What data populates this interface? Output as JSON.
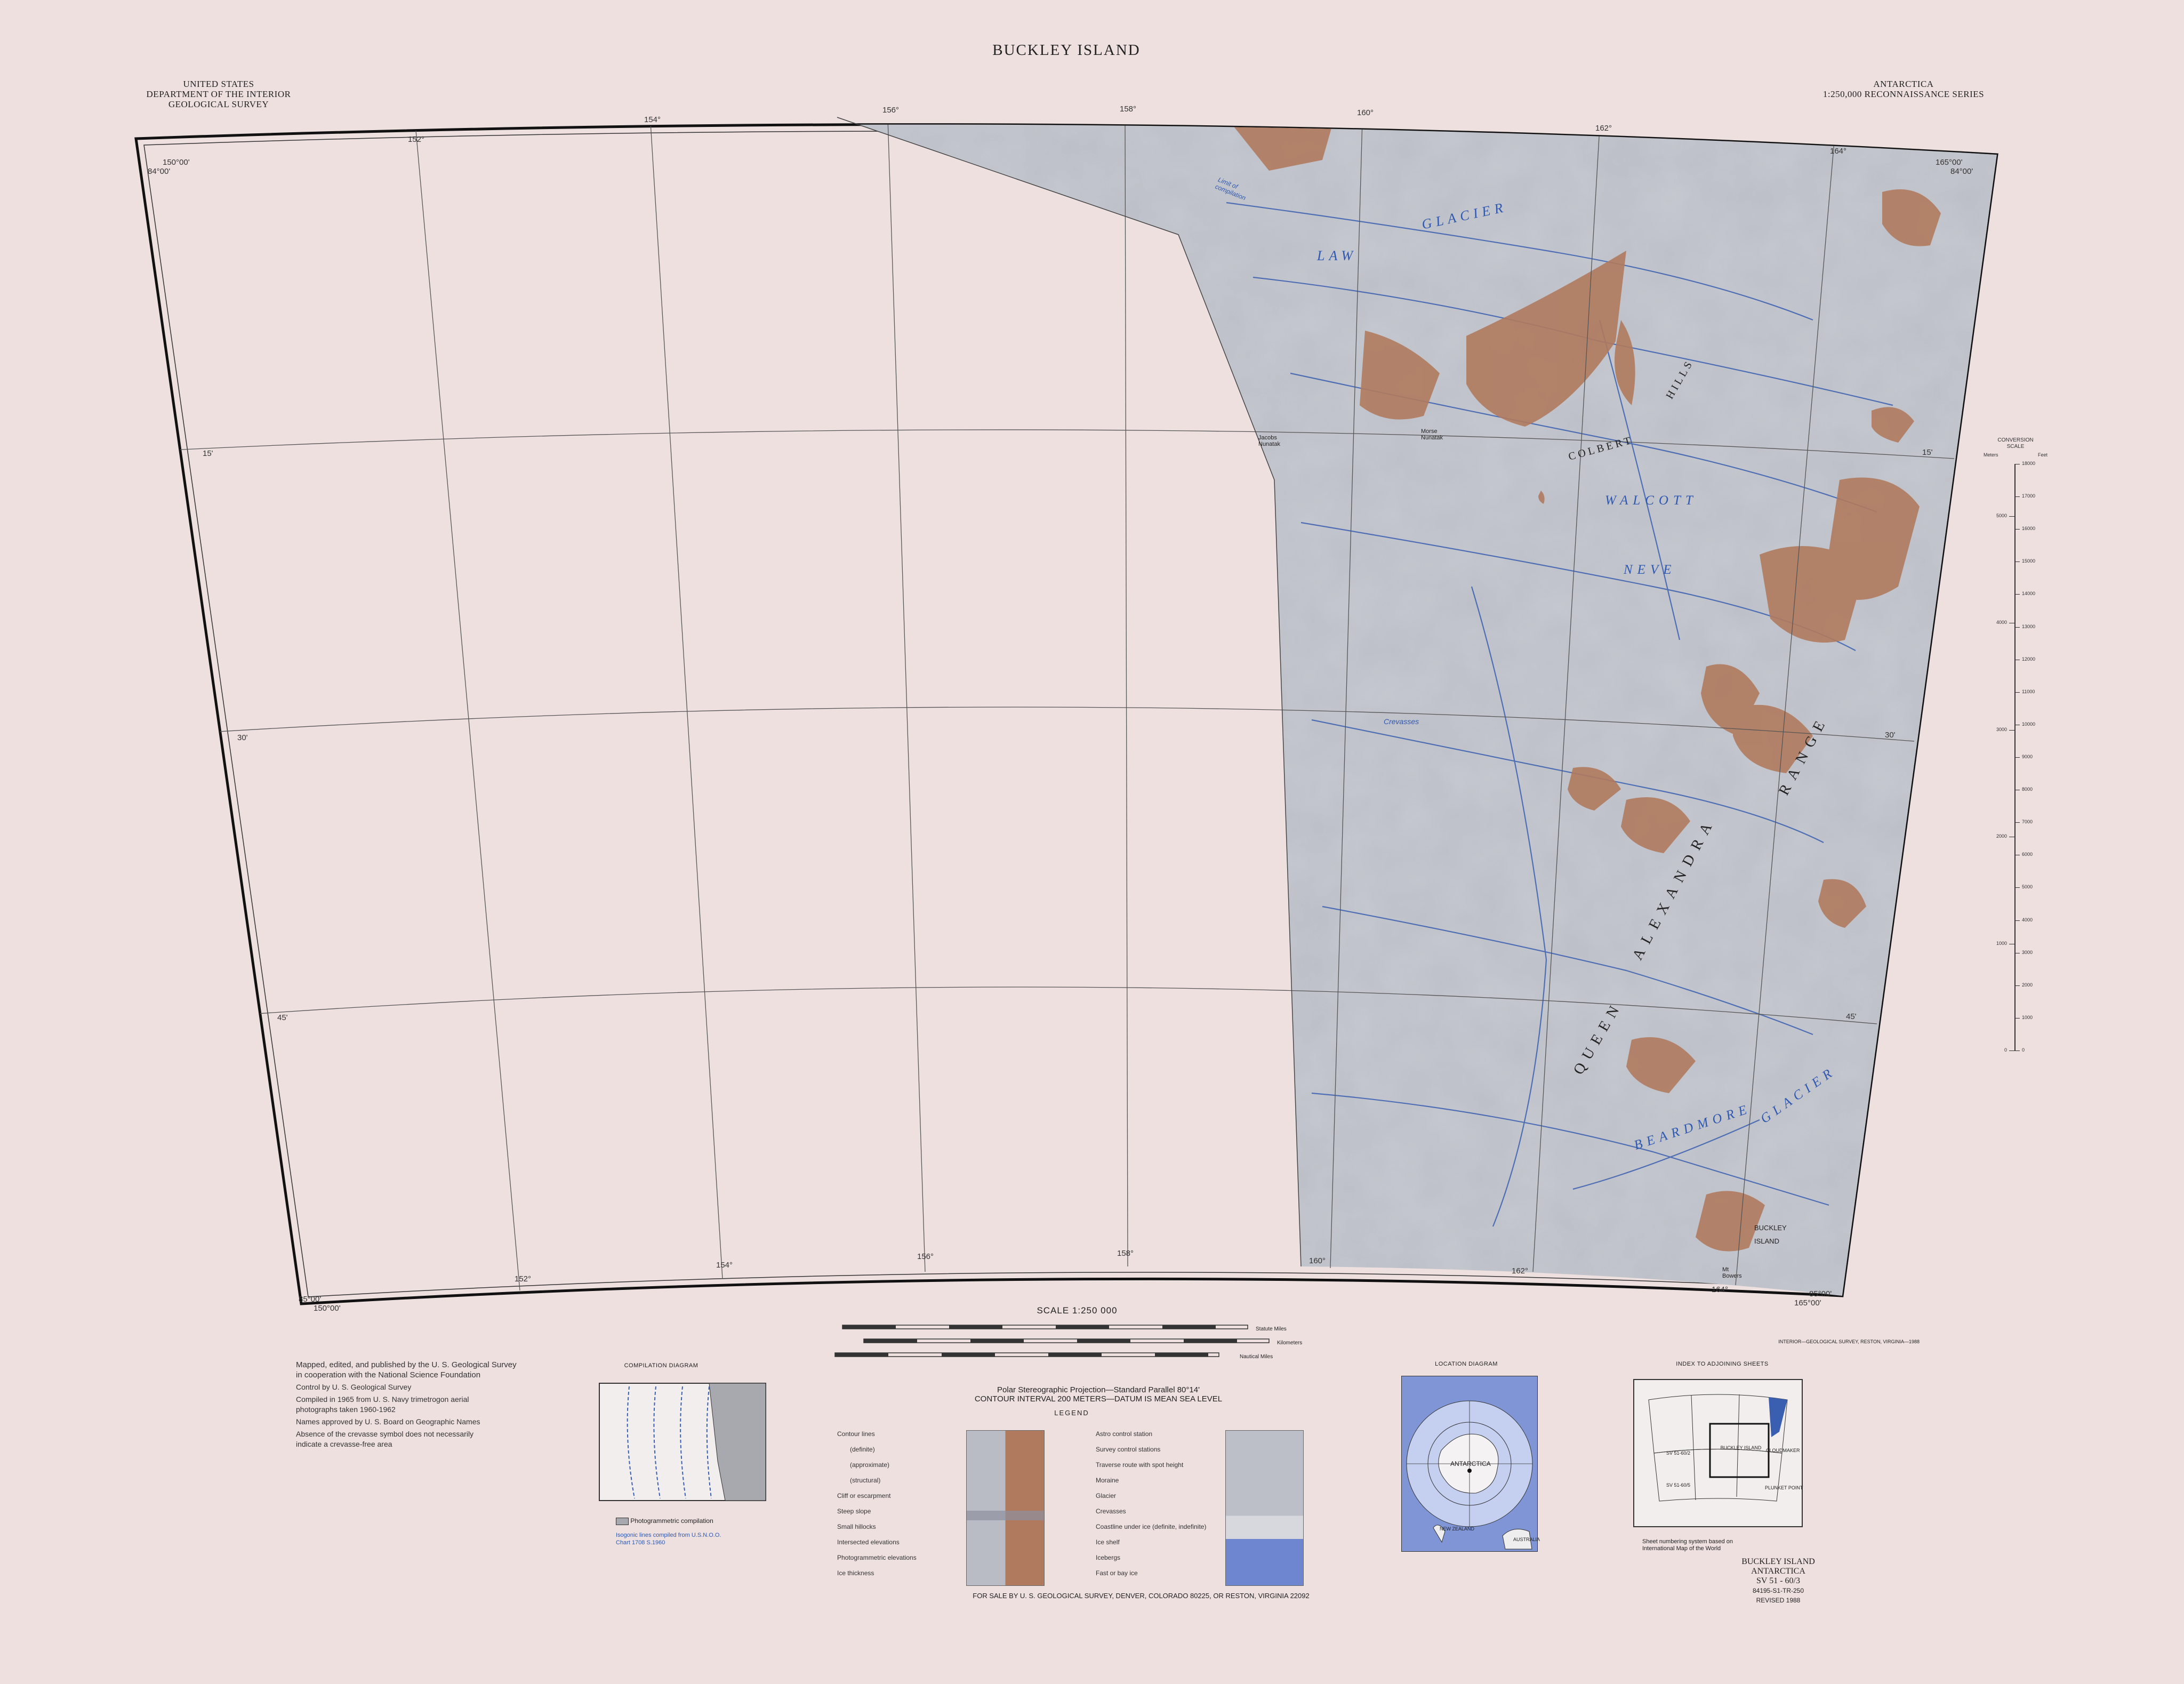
{
  "header": {
    "title": "BUCKLEY ISLAND",
    "agency": [
      "UNITED STATES",
      "DEPARTMENT OF THE INTERIOR",
      "GEOLOGICAL SURVEY"
    ],
    "series": [
      "ANTARCTICA",
      "1:250,000 RECONNAISSANCE SERIES"
    ]
  },
  "graticule": {
    "top_longitudes": [
      "152°",
      "154°",
      "156°",
      "158°",
      "160°",
      "162°",
      "164°"
    ],
    "bottom_longitudes": [
      "152°",
      "154°",
      "156°",
      "158°",
      "160°",
      "162°",
      "164°"
    ],
    "corner_tl": [
      "150°00'",
      "84°00'"
    ],
    "corner_tr": [
      "165°00'",
      "84°00'"
    ],
    "corner_bl": [
      "85°00'",
      "150°00'"
    ],
    "corner_br": [
      "85°00'",
      "165°00'"
    ],
    "left_latitudes": [
      "15'",
      "30'",
      "45'"
    ],
    "right_latitudes": [
      "15'",
      "30'",
      "45'"
    ]
  },
  "place_names": {
    "law_glacier": [
      "LAW",
      "GLACIER"
    ],
    "colbert_hills": [
      "COLBERT",
      "HILLS"
    ],
    "walcott_neve": [
      "WALCOTT",
      "NEVE"
    ],
    "queen_alexandra_range": [
      "QUEEN",
      "ALEXANDRA",
      "RANGE"
    ],
    "beardmore_glacier": [
      "BEARDMORE",
      "GLACIER"
    ],
    "buckley_island": [
      "BUCKLEY",
      "ISLAND"
    ],
    "crevasses": "Crevasses",
    "limit_of_compilation": "Limit of compilation",
    "morse_nunatak": "Morse Nunatak",
    "jacobs_nunatak": "Jacobs Nunatak",
    "mt_bowers": "Mt Bowers"
  },
  "elevation_scale": {
    "title": [
      "CONVERSION",
      "SCALE"
    ],
    "units": [
      "Meters",
      "Feet"
    ],
    "meters": [
      "0",
      "1000",
      "2000",
      "3000",
      "4000",
      "5000"
    ],
    "feet": [
      "0",
      "1000",
      "2000",
      "3000",
      "4000",
      "5000",
      "6000",
      "7000",
      "8000",
      "9000",
      "10000",
      "11000",
      "12000",
      "13000",
      "14000",
      "15000",
      "16000",
      "17000",
      "18000"
    ]
  },
  "footer": {
    "credits": [
      "Mapped, edited, and published by the U. S. Geological Survey",
      "in cooperation with the National Science Foundation",
      "Control by U. S. Geological Survey",
      "Compiled in 1965 from U. S. Navy trimetrogon aerial",
      "photographs taken 1960-1962",
      "Names approved by U. S. Board on Geographic Names",
      "Absence of the crevasse symbol does not necessarily",
      "indicate a crevasse-free area"
    ],
    "compilation_title": "COMPILATION DIAGRAM",
    "compilation_legend": "Photogrammetric compilation",
    "compilation_note": [
      "Isogonic lines compiled from U.S.N.O.O.",
      "Chart 1708 S.1960"
    ],
    "scale_title": "SCALE 1:250 000",
    "scale_units": [
      "Statute Miles",
      "Kilometers",
      "Nautical Miles"
    ],
    "projection": "Polar Stereographic Projection—Standard Parallel 80°14'",
    "contour": "CONTOUR INTERVAL 200 METERS—DATUM IS MEAN SEA LEVEL",
    "legend_title": "LEGEND",
    "legend_left": [
      "Contour lines",
      "(definite)",
      "(approximate)",
      "(structural)",
      "Cliff or escarpment",
      "Steep slope",
      "Small hillocks",
      "Intersected elevations",
      "Photogrammetric elevations",
      "Ice thickness"
    ],
    "legend_right": [
      "Astro control station",
      "Survey control stations",
      "Traverse route with spot height",
      "Moraine",
      "Glacier",
      "Crevasses",
      "Coastline under ice (definite, indefinite)",
      "Ice shelf",
      "Icebergs",
      "Fast or bay ice"
    ],
    "location_title": "LOCATION DIAGRAM",
    "location_labels": [
      "ANTARCTICA",
      "NEW ZEALAND",
      "AUSTRALIA"
    ],
    "index_title": "INDEX TO ADJOINING SHEETS",
    "index_labels": [
      "BUCKLEY ISLAND",
      "CLOUDMAKER",
      "PLUNKET POINT",
      "SV 51-60/2",
      "SV 51-60/5"
    ],
    "index_note": [
      "Sheet numbering system based on",
      "International Map of the World"
    ],
    "sheet_id": [
      "BUCKLEY ISLAND",
      "ANTARCTICA",
      "SV 51 - 60/3",
      "84195-S1-TR-250",
      "REVISED 1988"
    ],
    "for_sale": "FOR SALE BY U. S. GEOLOGICAL SURVEY, DENVER, COLORADO 80225, OR RESTON, VIRGINIA 22092",
    "printer": "INTERIOR—GEOLOGICAL SURVEY, RESTON, VIRGINIA—1988"
  },
  "colors": {
    "paper": "#ede0df",
    "ice": "#b9bcc4",
    "rock": "#b07a5e",
    "contour": "#3a5fb0",
    "neatline": "#111111"
  }
}
